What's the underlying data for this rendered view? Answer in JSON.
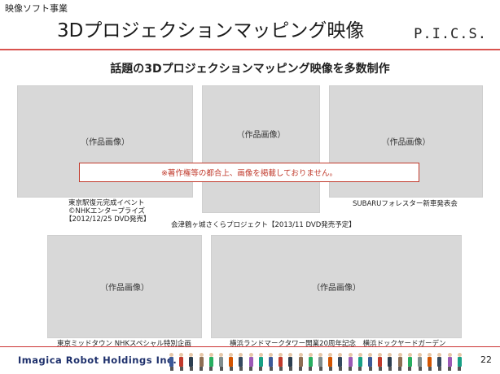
{
  "header": {
    "section_label": "映像ソフト事業",
    "title": "3Dプロジェクションマッピング映像",
    "logo": "P.I.C.S."
  },
  "headline": "話題の3Dプロジェクションマッピング映像を多数制作",
  "placeholder_label": "（作品画像）",
  "notice": "※著作権等の都合上、画像を掲載しておりません。",
  "works": [
    {
      "caption_lines": [
        "東京駅復元完成イベント",
        "©NHKエンタープライズ",
        "【2012/12/25 DVD発売】"
      ]
    },
    {
      "caption_lines": [
        "会津鶴ヶ城さくらプロジェクト【2013/11 DVD発売予定】"
      ]
    },
    {
      "caption_lines": [
        "SUBARUフォレスター新車発表会"
      ]
    },
    {
      "caption_lines": [
        "東京ミッドタウン NHKスペシャル特別企画"
      ]
    },
    {
      "caption_lines": [
        "横浜ランドマークタワー開業20周年記念　横浜ドックヤードガーデン"
      ]
    }
  ],
  "footer": {
    "company": "Imagica Robot Holdings Inc.",
    "page_number": "22"
  },
  "colors": {
    "accent": "#d9534f",
    "notice": "#c0392b",
    "placeholder": "#d8d8d8",
    "company": "#1d2f6b"
  }
}
